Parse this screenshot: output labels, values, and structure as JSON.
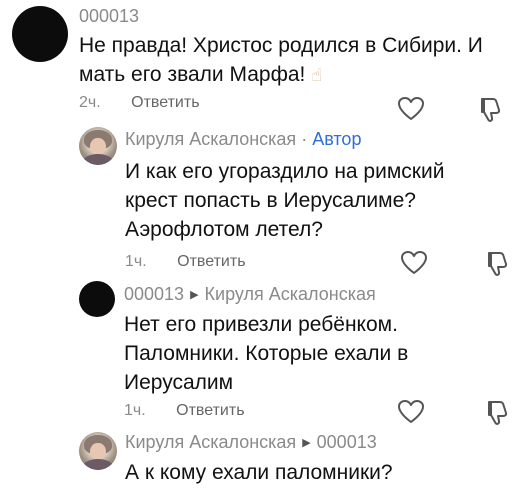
{
  "comments": [
    {
      "author": "000013",
      "text_line1": "Не правда! Христос родился в Сибири. И",
      "text_line2": "мать его звали Марфа!",
      "emoji": "☝",
      "time": "2ч.",
      "reply_label": "Ответить"
    },
    {
      "author": "Кируля Аскалонская",
      "separator": "·",
      "author_tag": "Автор",
      "text_line1": "И как его угораздило на римский",
      "text_line2": "крест попасть в Иерусалиме?",
      "text_line3": "Аэрофлотом летел?",
      "time": "1ч.",
      "reply_label": "Ответить"
    },
    {
      "author": "000013",
      "arrow": "▶",
      "reply_to": "Кируля Аскалонская",
      "text_line1": "Нет его привезли ребёнком.",
      "text_line2": "Паломники. Которые ехали в",
      "text_line3": "Иерусалим",
      "time": "1ч.",
      "reply_label": "Ответить"
    },
    {
      "author": "Кируля Аскалонская",
      "arrow": "▶",
      "reply_to": "000013",
      "text_line1": "А к кому ехали паломники?"
    }
  ]
}
